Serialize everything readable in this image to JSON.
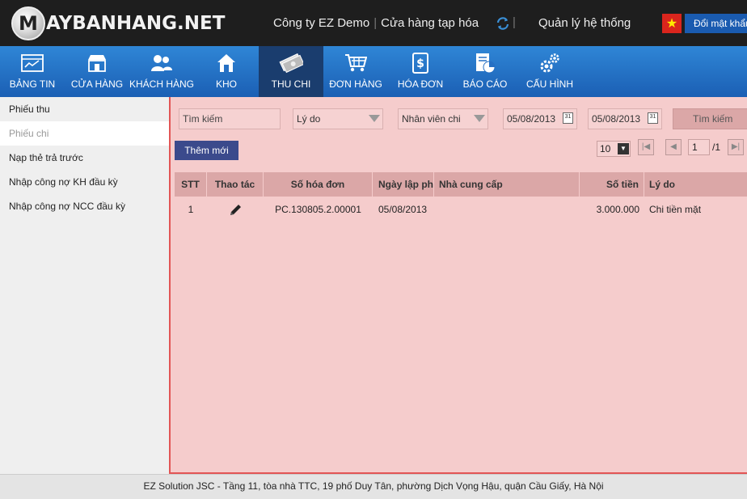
{
  "header": {
    "logo_letter": "M",
    "logo_text": "AYBANHANG.NET",
    "company": "Công ty EZ Demo",
    "store": "Cửa hàng tạp hóa",
    "system_mgmt": "Quản lý hệ thống",
    "change_password": "Đổi mật khẩu"
  },
  "nav": [
    {
      "label": "BẢNG TIN",
      "icon": "dashboard-icon"
    },
    {
      "label": "CỬA HÀNG",
      "icon": "store-icon"
    },
    {
      "label": "KHÁCH HÀNG",
      "icon": "customers-icon"
    },
    {
      "label": "KHO",
      "icon": "warehouse-icon"
    },
    {
      "label": "THU CHI",
      "icon": "cash-icon"
    },
    {
      "label": "ĐƠN HÀNG",
      "icon": "cart-icon"
    },
    {
      "label": "HÓA ĐƠN",
      "icon": "invoice-icon"
    },
    {
      "label": "BÁO CÁO",
      "icon": "report-icon"
    },
    {
      "label": "CẤU HÌNH",
      "icon": "settings-icon"
    }
  ],
  "sidebar": {
    "items": [
      {
        "label": "Phiếu thu"
      },
      {
        "label": "Phiếu chi"
      },
      {
        "label": "Nạp thẻ trả trước"
      },
      {
        "label": "Nhập công nợ KH đầu kỳ"
      },
      {
        "label": "Nhập công nợ NCC đầu kỳ"
      }
    ]
  },
  "filters": {
    "search_placeholder": "Tìm kiếm",
    "reason": "Lý do",
    "employee": "Nhân viên chi",
    "date_from": "05/08/2013",
    "date_to": "05/08/2013",
    "search_button": "Tìm kiếm",
    "add_button": "Thêm mới"
  },
  "pager": {
    "page_size": "10",
    "current_page": "1",
    "total": "/1"
  },
  "table": {
    "headers": [
      "STT",
      "Thao tác",
      "Số hóa đơn",
      "Ngày lập phiếu",
      "Nhà cung cấp",
      "Số tiền",
      "Lý do"
    ],
    "rows": [
      {
        "stt": "1",
        "invoice": "PC.130805.2.00001",
        "date": "05/08/2013",
        "supplier": "",
        "amount": "3.000.000",
        "reason": "Chi tiền mặt"
      }
    ]
  },
  "footer": "EZ Solution JSC - Tầng 11, tòa nhà TTC, 19 phố Duy Tân, phường Dịch Vọng Hậu, quận Cầu Giấy, Hà Nội"
}
